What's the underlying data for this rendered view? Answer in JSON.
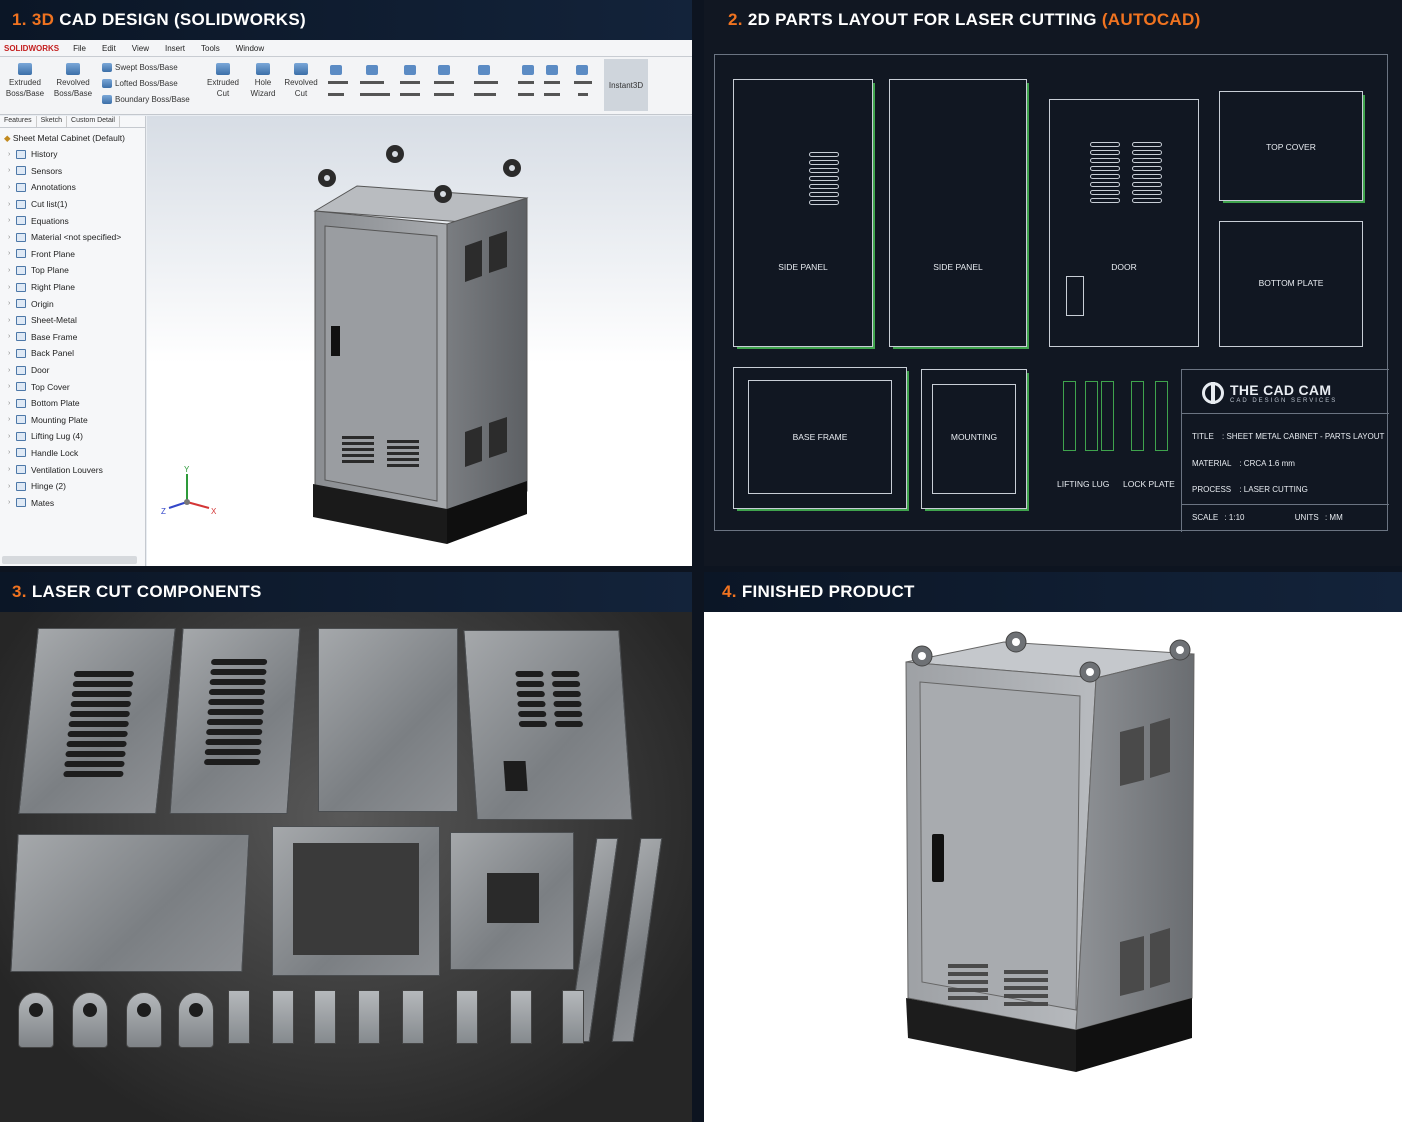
{
  "panels": {
    "p1": {
      "num": "1.",
      "num_accent": "3D",
      "title": "CAD DESIGN (SOLIDWORKS)"
    },
    "p2": {
      "num": "2.",
      "title": "2D PARTS LAYOUT FOR LASER CUTTING",
      "accent": "(AUTOCAD)"
    },
    "p3": {
      "num": "3.",
      "title": "LASER CUT COMPONENTS"
    },
    "p4": {
      "num": "4.",
      "title": "FINISHED PRODUCT"
    }
  },
  "solidworks": {
    "app": "SOLIDWORKS",
    "menu": [
      "File",
      "Edit",
      "View",
      "Insert",
      "Tools",
      "Window"
    ],
    "ribbon": {
      "extruded_boss": [
        "Extruded",
        "Boss/Base"
      ],
      "revolved_boss": [
        "Revolved",
        "Boss/Base"
      ],
      "swept": "Swept Boss/Base",
      "lofted": "Lofted Boss/Base",
      "boundary": "Boundary Boss/Base",
      "extruded_cut": [
        "Extruded",
        "Cut"
      ],
      "hole_wizard": [
        "Hole",
        "Wizard"
      ],
      "revolved_cut": [
        "Revolved",
        "Cut"
      ],
      "instant3d": "Instant3D"
    },
    "tabs": [
      "Features",
      "Sketch",
      "Custom Detail"
    ],
    "tree_root": "Sheet Metal Cabinet (Default)",
    "tree": [
      "History",
      "Sensors",
      "Annotations",
      "Cut list(1)",
      "Equations",
      "Material <not specified>",
      "Front Plane",
      "Top Plane",
      "Right Plane",
      "Origin",
      "Sheet-Metal",
      "Base Frame",
      "Back Panel",
      "Door",
      "Top Cover",
      "Bottom Plate",
      "Mounting Plate",
      "Lifting Lug (4)",
      "Handle Lock",
      "Ventilation Louvers",
      "Hinge (2)",
      "Mates"
    ],
    "triad": {
      "y": "Y",
      "z": "Z",
      "x": "X"
    }
  },
  "autocad": {
    "parts": {
      "side1": "SIDE PANEL",
      "side2": "SIDE PANEL",
      "door": "DOOR",
      "top": "TOP COVER",
      "bottom": "BOTTOM PLATE",
      "base": "BASE FRAME",
      "mount": "MOUNTING",
      "lug": "LIFTING LUG",
      "lock": "LOCK PLATE"
    },
    "logo": {
      "main": "THE CAD CAM",
      "sub": "CAD DESIGN SERVICES"
    },
    "title_block": {
      "title_k": "TITLE",
      "title_v": ": SHEET METAL CABINET - PARTS LAYOUT",
      "material_k": "MATERIAL",
      "material_v": ":   CRCA 1.6 mm",
      "process_k": "PROCESS",
      "process_v": ":   LASER CUTTING",
      "scale_k": "SCALE",
      "scale_v": ": 1:10",
      "units_k": "UNITS",
      "units_v": ": MM"
    }
  },
  "colors": {
    "accent": "#f07320",
    "cad_green": "#3fa34d"
  }
}
